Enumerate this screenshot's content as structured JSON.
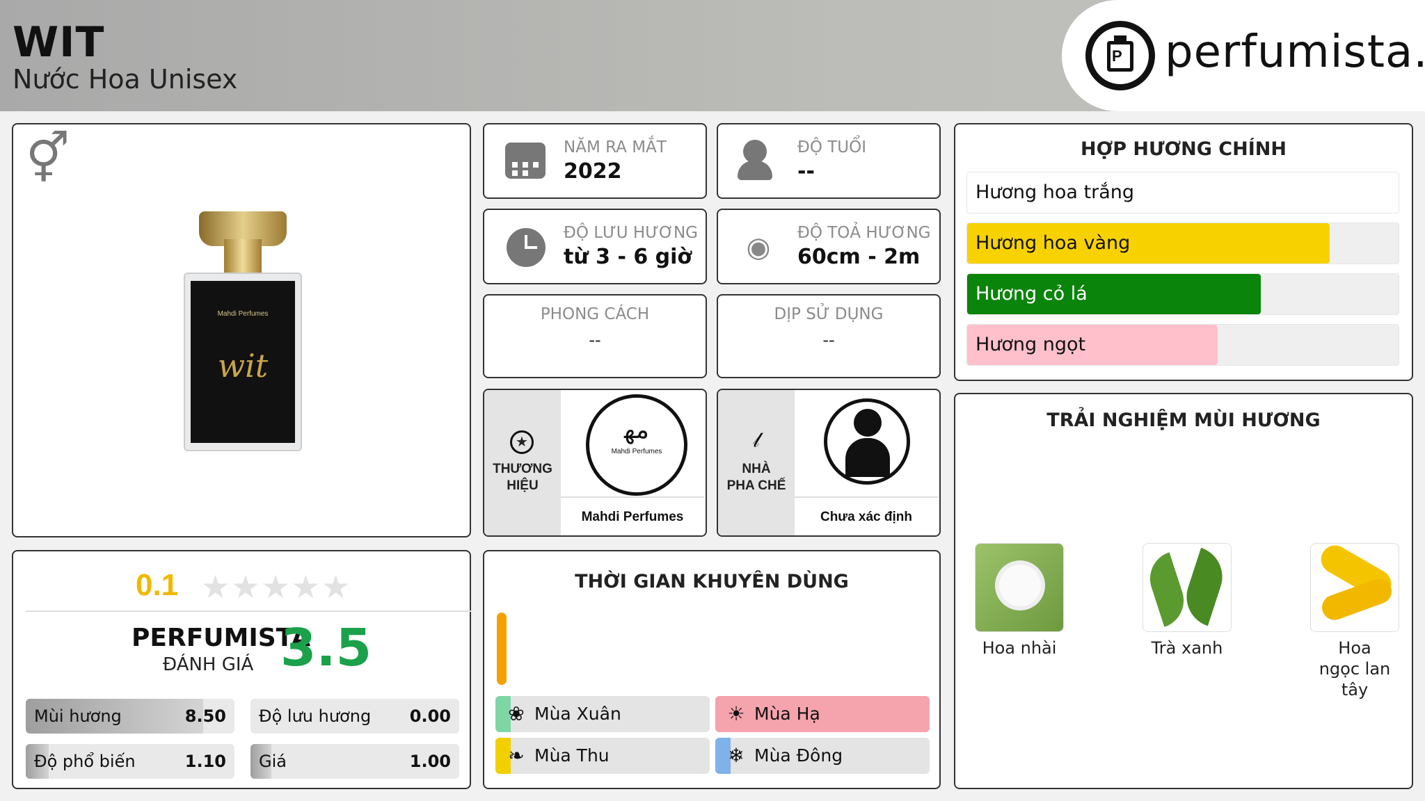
{
  "header": {
    "title": "WIT",
    "subtitle": "Nước Hoa Unisex",
    "site": "perfumista.vn"
  },
  "product": {
    "gender_icon": "gender-unisex-icon",
    "bottle_label_brand": "Mahdi Perfumes",
    "bottle_label_script": "wit"
  },
  "info": {
    "launch_year": {
      "label": "NĂM RA MẮT",
      "value": "2022",
      "icon": "calendar-icon"
    },
    "age": {
      "label": "ĐỘ TUỔI",
      "value": "--",
      "icon": "person-icon"
    },
    "longevity": {
      "label": "ĐỘ LƯU HƯƠNG",
      "value": "từ 3 - 6 giờ",
      "icon": "clock-icon"
    },
    "sillage": {
      "label": "ĐỘ TOẢ HƯƠNG",
      "value": "60cm - 2m",
      "icon": "sillage-icon"
    },
    "style": {
      "label": "PHONG CÁCH",
      "value": "--"
    },
    "occasion": {
      "label": "DỊP SỬ DỤNG",
      "value": "--"
    }
  },
  "brand": {
    "label": "THƯƠNG HIỆU",
    "name": "Mahdi Perfumes",
    "icon": "star-badge-icon",
    "logo_text": "Mahdi Perfumes"
  },
  "perfumer": {
    "label": "NHÀ PHA CHẾ",
    "name": "Chưa xác định",
    "icon": "nose-icon"
  },
  "accords": {
    "title": "HỢP HƯƠNG CHÍNH",
    "items": [
      {
        "label": "Hương hoa trắng",
        "level": 1.0,
        "color": "#ffffff"
      },
      {
        "label": "Hương hoa vàng",
        "level": 0.84,
        "color": "#f7d200"
      },
      {
        "label": "Hương cỏ lá",
        "level": 0.68,
        "color": "#0a840a"
      },
      {
        "label": "Hương ngọt",
        "level": 0.58,
        "color": "#ffc0cb"
      }
    ]
  },
  "notes": {
    "title": "TRẢI NGHIỆM MÙI HƯƠNG",
    "items": [
      {
        "label": "Hoa nhài"
      },
      {
        "label": "Trà xanh"
      },
      {
        "label": "Hoa ngọc lan tây"
      }
    ]
  },
  "rating": {
    "user_score": "0.1",
    "stars_filled": 0.02,
    "perfumista_label": "PERFUMISTA",
    "perfumista_sub": "ĐÁNH GIÁ",
    "perfumista_score": "3.5",
    "metrics": [
      {
        "name": "Mùi hương",
        "value": "8.50",
        "level": 0.85
      },
      {
        "name": "Độ lưu hương",
        "value": "0.00",
        "level": 0.0
      },
      {
        "name": "Độ phổ biến",
        "value": "1.10",
        "level": 0.11
      },
      {
        "name": "Giá",
        "value": "1.00",
        "level": 0.1
      }
    ]
  },
  "usage": {
    "title": "THỜI GIAN KHUYÊN DÙNG",
    "day_night_color": "#f4a100",
    "seasons": [
      {
        "label": "Mùa Xuân",
        "icon": "spring-icon",
        "accent": "#7ed6a4",
        "highlight": false
      },
      {
        "label": "Mùa Hạ",
        "icon": "sun-icon",
        "accent": "#f5a3ad",
        "highlight": true
      },
      {
        "label": "Mùa Thu",
        "icon": "leaf-icon",
        "accent": "#f2d000",
        "highlight": false
      },
      {
        "label": "Mùa Đông",
        "icon": "snowflake-icon",
        "accent": "#7fb2e8",
        "highlight": false
      }
    ]
  }
}
